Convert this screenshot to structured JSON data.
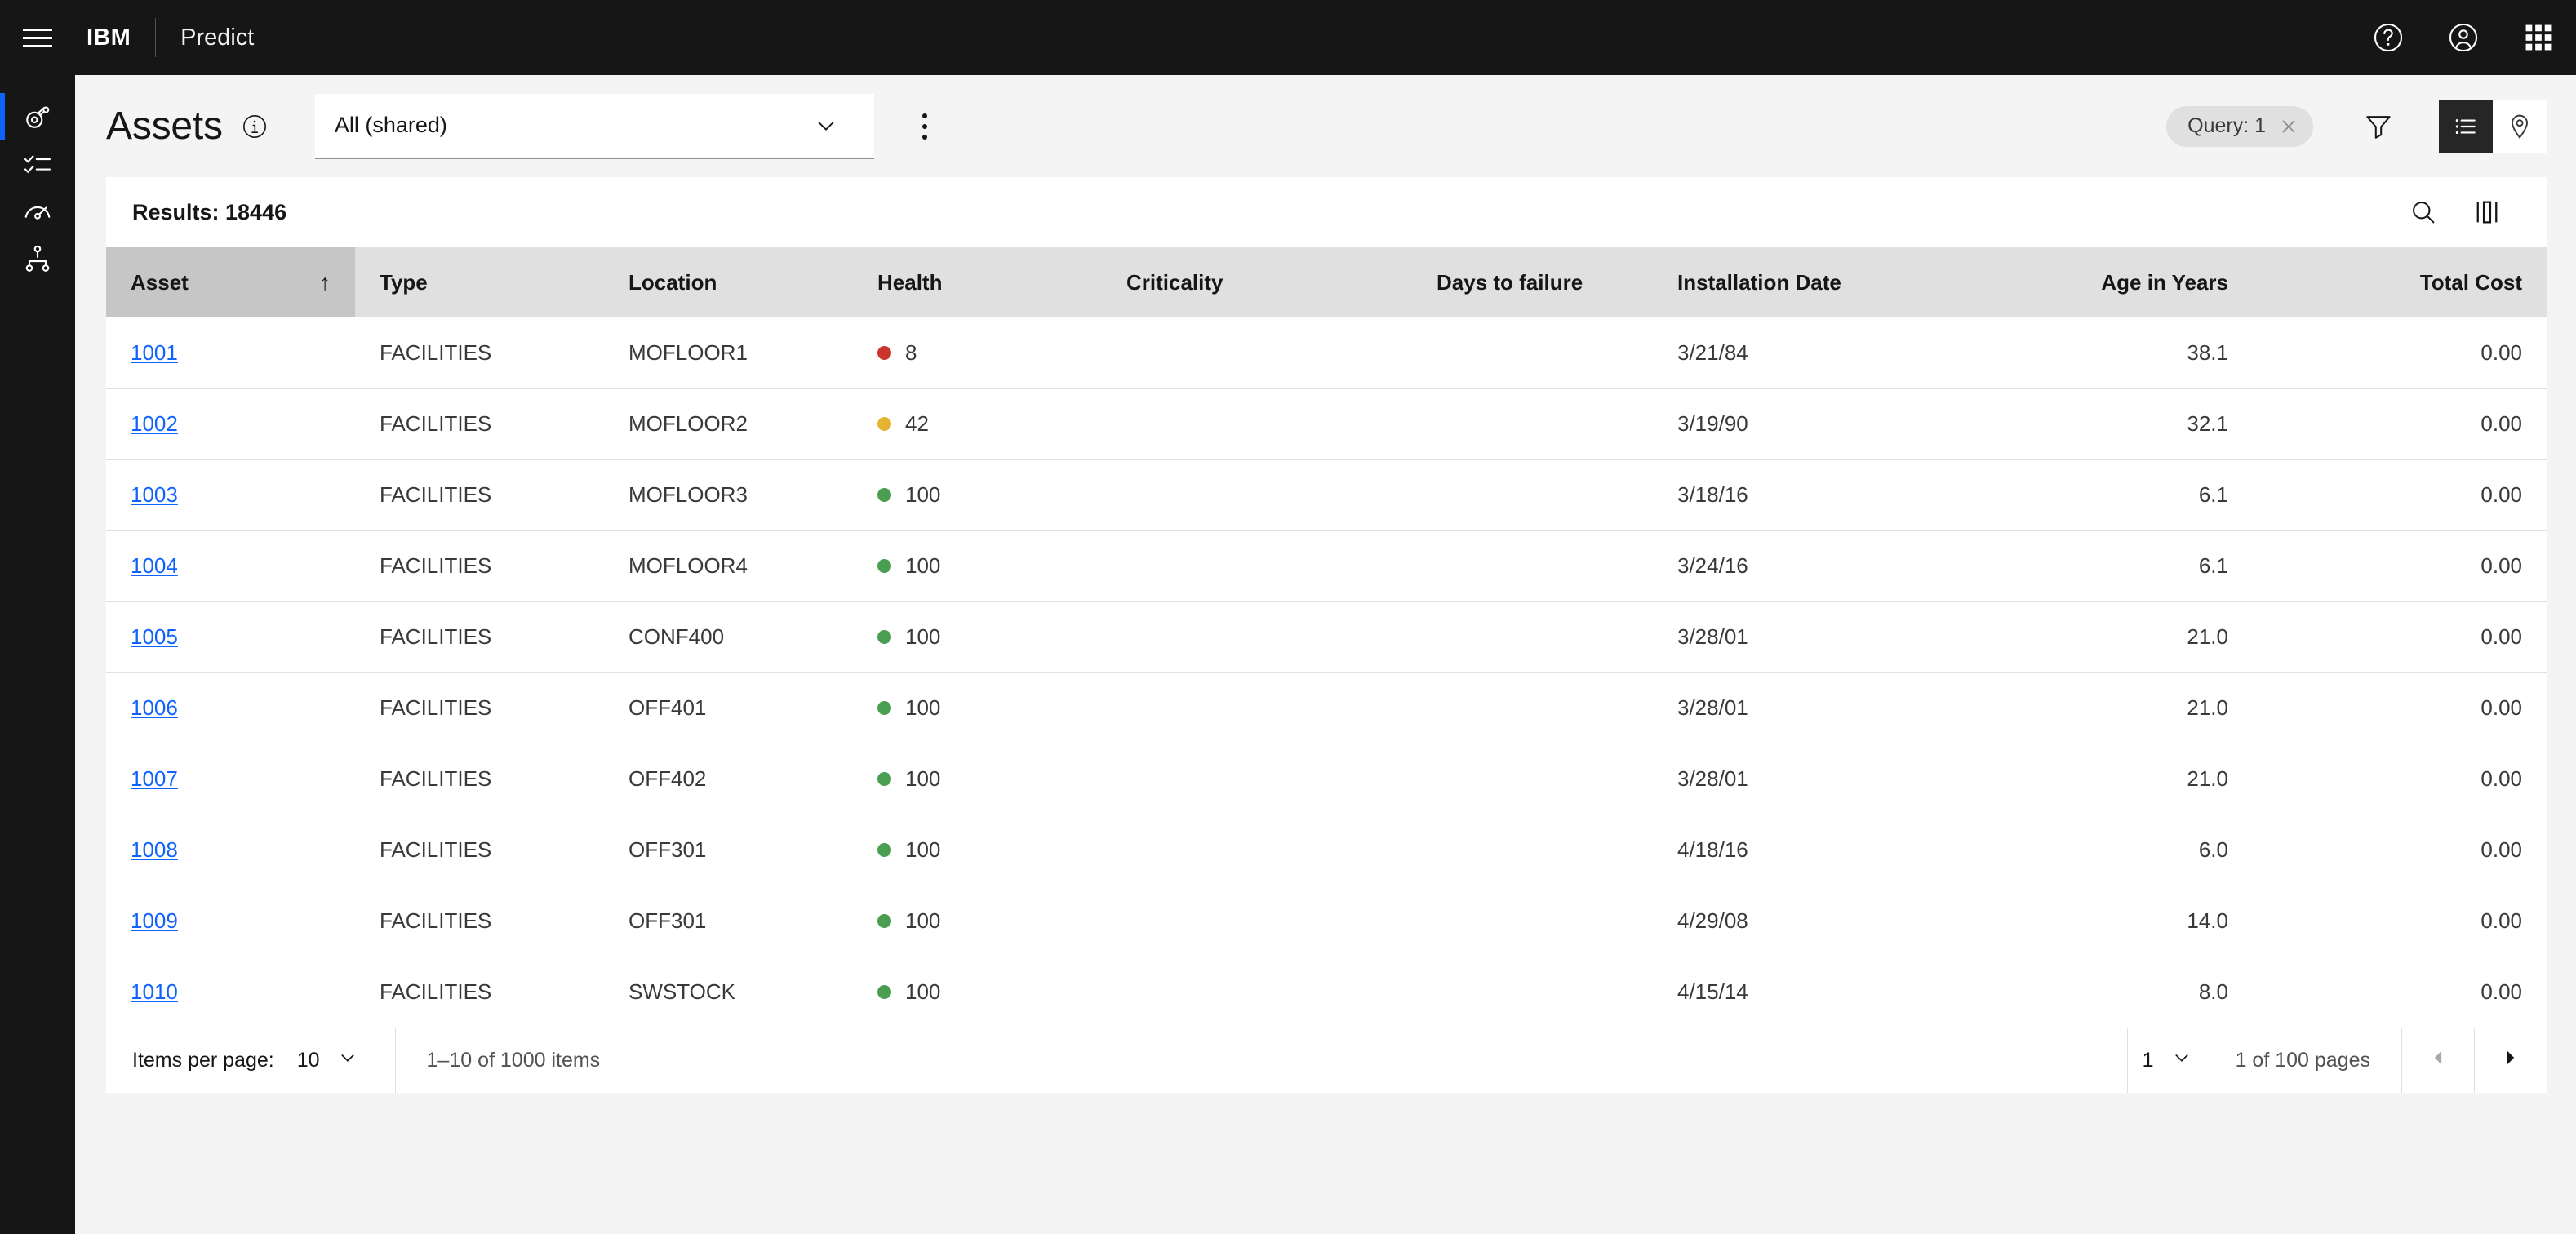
{
  "header": {
    "menu_icon": "hamburger-menu-icon",
    "brand": "IBM",
    "app_name": "Predict",
    "help_icon": "help-circle-icon",
    "account_icon": "user-avatar-icon",
    "switcher_icon": "app-switcher-icon"
  },
  "sidebar": {
    "items": [
      {
        "icon": "asset-pulley-icon",
        "name": "assets",
        "active": true
      },
      {
        "icon": "checklist-icon",
        "name": "work-orders",
        "active": false
      },
      {
        "icon": "gauge-meter-icon",
        "name": "monitor",
        "active": false
      },
      {
        "icon": "hierarchy-tree-icon",
        "name": "hierarchy",
        "active": false
      }
    ]
  },
  "toolbar": {
    "title": "Assets",
    "info_icon": "info-circle-icon",
    "view_select": {
      "value": "All (shared)",
      "chevron_icon": "chevron-down-icon"
    },
    "overflow_icon": "overflow-menu-vertical-icon",
    "query_tag": {
      "label": "Query: 1",
      "close_icon": "close-icon"
    },
    "filter_icon": "filter-funnel-icon",
    "view_toggle": {
      "list_icon": "list-view-icon",
      "map_icon": "map-pin-icon",
      "active": "list"
    }
  },
  "card": {
    "results_label": "Results: 18446",
    "search_icon": "search-icon",
    "columns_icon": "column-settings-icon"
  },
  "table": {
    "sort_arrow": "↑",
    "sorted_column": "Asset",
    "columns": [
      {
        "label": "Asset",
        "align": "left"
      },
      {
        "label": "Type",
        "align": "left"
      },
      {
        "label": "Location",
        "align": "left"
      },
      {
        "label": "Health",
        "align": "left"
      },
      {
        "label": "Criticality",
        "align": "left"
      },
      {
        "label": "Days to failure",
        "align": "left"
      },
      {
        "label": "Installation Date",
        "align": "left"
      },
      {
        "label": "Age in Years",
        "align": "right"
      },
      {
        "label": "Total Cost",
        "align": "right"
      }
    ],
    "rows": [
      {
        "asset": "1001",
        "type": "FACILITIES",
        "location": "MOFLOOR1",
        "health": "8",
        "health_status": "critical",
        "criticality": "",
        "days_to_failure": "",
        "installation_date": "3/21/84",
        "age_in_years": "38.1",
        "total_cost": "0.00"
      },
      {
        "asset": "1002",
        "type": "FACILITIES",
        "location": "MOFLOOR2",
        "health": "42",
        "health_status": "warning",
        "criticality": "",
        "days_to_failure": "",
        "installation_date": "3/19/90",
        "age_in_years": "32.1",
        "total_cost": "0.00"
      },
      {
        "asset": "1003",
        "type": "FACILITIES",
        "location": "MOFLOOR3",
        "health": "100",
        "health_status": "healthy",
        "criticality": "",
        "days_to_failure": "",
        "installation_date": "3/18/16",
        "age_in_years": "6.1",
        "total_cost": "0.00"
      },
      {
        "asset": "1004",
        "type": "FACILITIES",
        "location": "MOFLOOR4",
        "health": "100",
        "health_status": "healthy",
        "criticality": "",
        "days_to_failure": "",
        "installation_date": "3/24/16",
        "age_in_years": "6.1",
        "total_cost": "0.00"
      },
      {
        "asset": "1005",
        "type": "FACILITIES",
        "location": "CONF400",
        "health": "100",
        "health_status": "healthy",
        "criticality": "",
        "days_to_failure": "",
        "installation_date": "3/28/01",
        "age_in_years": "21.0",
        "total_cost": "0.00"
      },
      {
        "asset": "1006",
        "type": "FACILITIES",
        "location": "OFF401",
        "health": "100",
        "health_status": "healthy",
        "criticality": "",
        "days_to_failure": "",
        "installation_date": "3/28/01",
        "age_in_years": "21.0",
        "total_cost": "0.00"
      },
      {
        "asset": "1007",
        "type": "FACILITIES",
        "location": "OFF402",
        "health": "100",
        "health_status": "healthy",
        "criticality": "",
        "days_to_failure": "",
        "installation_date": "3/28/01",
        "age_in_years": "21.0",
        "total_cost": "0.00"
      },
      {
        "asset": "1008",
        "type": "FACILITIES",
        "location": "OFF301",
        "health": "100",
        "health_status": "healthy",
        "criticality": "",
        "days_to_failure": "",
        "installation_date": "4/18/16",
        "age_in_years": "6.0",
        "total_cost": "0.00"
      },
      {
        "asset": "1009",
        "type": "FACILITIES",
        "location": "OFF301",
        "health": "100",
        "health_status": "healthy",
        "criticality": "",
        "days_to_failure": "",
        "installation_date": "4/29/08",
        "age_in_years": "14.0",
        "total_cost": "0.00"
      },
      {
        "asset": "1010",
        "type": "FACILITIES",
        "location": "SWSTOCK",
        "health": "100",
        "health_status": "healthy",
        "criticality": "",
        "days_to_failure": "",
        "installation_date": "4/15/14",
        "age_in_years": "8.0",
        "total_cost": "0.00"
      }
    ]
  },
  "pagination": {
    "items_per_page_label": "Items per page:",
    "items_per_page_value": "10",
    "range_text": "1–10 of 1000 items",
    "page_value": "1",
    "pages_text": "1 of 100 pages",
    "prev_icon": "caret-left-icon",
    "next_icon": "caret-right-icon"
  },
  "colors": {
    "accent_blue": "#0f62fe",
    "health_critical": "#c9342c",
    "health_warning": "#e5b334",
    "health_healthy": "#4a9e52",
    "header_bg": "#161616"
  }
}
